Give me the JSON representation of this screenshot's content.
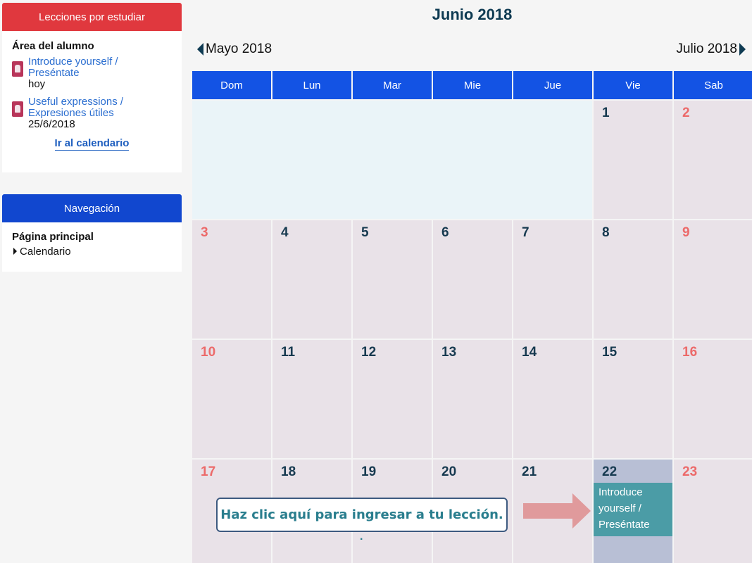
{
  "sidebar": {
    "lessons_block": {
      "header": "Lecciones por estudiar",
      "title": "Área del alumno",
      "items": [
        {
          "link_line1": "Introduce yourself /",
          "link_line2": "Preséntate",
          "date": "hoy",
          "icon": "lesson-icon"
        },
        {
          "link_line1": "Useful expressions /",
          "link_line2": "Expresiones útiles",
          "date": "25/6/2018",
          "icon": "lesson-icon"
        }
      ],
      "calendar_link": "Ir al calendario"
    },
    "nav_block": {
      "header": "Navegación",
      "home": "Página principal",
      "calendar": "Calendario"
    }
  },
  "calendar": {
    "title": "Junio 2018",
    "prev_month": "Mayo 2018",
    "next_month": "Julio 2018",
    "weekdays": [
      "Dom",
      "Lun",
      "Mar",
      "Mie",
      "Jue",
      "Vie",
      "Sab"
    ],
    "weeks": [
      [
        "",
        "",
        "",
        "",
        "",
        "1",
        "2"
      ],
      [
        "3",
        "4",
        "5",
        "6",
        "7",
        "8",
        "9"
      ],
      [
        "10",
        "11",
        "12",
        "13",
        "14",
        "15",
        "16"
      ],
      [
        "17",
        "18",
        "19",
        "20",
        "21",
        "22",
        "23"
      ]
    ],
    "event": {
      "day": "22",
      "line1": "Introduce",
      "line2": "yourself /",
      "line3": "Preséntate"
    }
  },
  "callout": {
    "text": "Haz clic aquí para ingresar a tu lección.",
    "dot": "."
  },
  "colors": {
    "lessons_header": "#e0383e",
    "nav_header": "#1147cf",
    "weekday_header": "#1353e4",
    "weekend_number": "#ec6a6a",
    "event_bg": "#4b9ca6",
    "today_bg": "#b8bfd5",
    "arrow": "#e09a9c"
  }
}
